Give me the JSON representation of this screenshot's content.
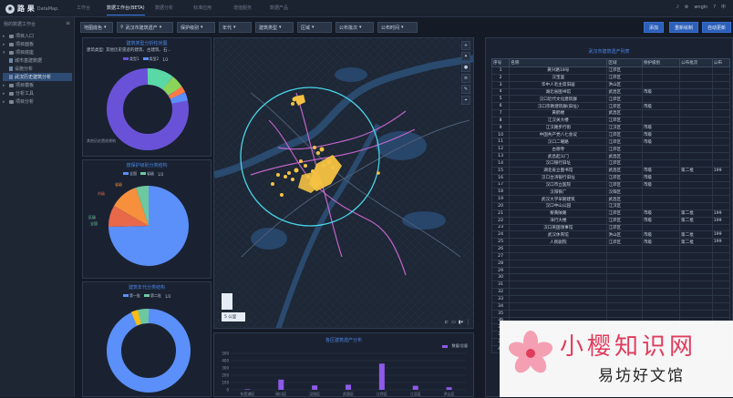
{
  "app": {
    "brand": "路 果",
    "sub": "DataMap.",
    "user": "wngln",
    "lang": "中"
  },
  "nav_tabs": [
    "工作台",
    "数据工作台(BETA)",
    "数据分析",
    "标准应用",
    "增值服务",
    "数据产品"
  ],
  "sidebar": {
    "header": "我的数据工作台",
    "items": [
      {
        "label": "项目入口",
        "level": 0,
        "type": "folder"
      },
      {
        "label": "项目面板",
        "level": 0,
        "type": "folder"
      },
      {
        "label": "项目底座",
        "level": 0,
        "type": "folder",
        "open": true
      },
      {
        "label": "城市基建数据",
        "level": 1,
        "type": "doc"
      },
      {
        "label": "设施分析",
        "level": 1,
        "type": "doc"
      },
      {
        "label": "武汉历史建筑分析",
        "level": 1,
        "type": "doc",
        "selected": true
      },
      {
        "label": "项目模板",
        "level": 0,
        "type": "folder"
      },
      {
        "label": "分析工具",
        "level": 0,
        "type": "folder"
      },
      {
        "label": "项目分析",
        "level": 0,
        "type": "folder"
      }
    ]
  },
  "toolbar": {
    "map_style": "地图底色",
    "layer": "武汉市建筑遗产",
    "filters": [
      "保护级别",
      "年代",
      "建筑类型",
      "区域",
      "公布批次",
      "公布时间"
    ],
    "actions": [
      "添加",
      "重新绘制",
      "自动更新"
    ]
  },
  "pie1": {
    "title": "建筑类型分析柱状图",
    "subtitle": "建筑类型: 其他历史遗迹的建筑、古建筑、石...",
    "legend": [
      "类型1",
      "类型2",
      "1/2"
    ],
    "footer": "其他历史遗迹建筑",
    "colors": [
      "#6a52d8",
      "#5b8ff9",
      "#5ad8a6",
      "#8bd45a",
      "#f6bd16",
      "#ff7a45"
    ]
  },
  "pie2": {
    "title": "按保护级别分类结构",
    "legend": [
      "全国",
      "省级",
      "1/2"
    ],
    "labels": [
      "省级",
      "市级",
      "区级",
      "全国"
    ],
    "colors": [
      "#5b8ff9",
      "#e8684a",
      "#f6903d",
      "#6dc8a0"
    ]
  },
  "pie3": {
    "title": "建筑年代分类结构",
    "legend": [
      "第一批",
      "第二批",
      "1/2"
    ],
    "colors": [
      "#5b8ff9",
      "#6dc8a0",
      "#f6bd16"
    ]
  },
  "map": {
    "scale": "5 公里",
    "north": "N"
  },
  "bottom_chart": {
    "title": "各区建筑遗产分布",
    "legend": "数量/总量",
    "y_ticks": [
      "500",
      "400",
      "300",
      "200",
      "100",
      "0"
    ],
    "x_labels": [
      "东西湖区",
      "硚口区",
      "汉阳区",
      "武昌区",
      "江岸区",
      "江汉区",
      "洪山区"
    ],
    "color": "#8e5ae8"
  },
  "chart_data": {
    "type": "bar",
    "title": "各区建筑遗产分布",
    "categories": [
      "东西湖区",
      "硚口区",
      "汉阳区",
      "武昌区",
      "江岸区",
      "江汉区",
      "洪山区"
    ],
    "values": [
      8,
      140,
      60,
      70,
      360,
      55,
      35
    ],
    "ylim": [
      0,
      500
    ]
  },
  "table": {
    "title": "武汉市建筑遗产列表",
    "columns": [
      "序号",
      "名称",
      "区域",
      "保护级别",
      "公布批次",
      "公布"
    ],
    "rows": [
      [
        "1",
        "黄兴路18号",
        "江岸区",
        "",
        "",
        ""
      ],
      [
        "2",
        "汉宝里",
        "江岸区",
        "",
        "",
        ""
      ],
      [
        "3",
        "华中人毛主席旧居",
        "洪山区",
        "",
        "",
        ""
      ],
      [
        "4",
        "湖北省图书馆",
        "武昌区",
        "市级",
        "",
        ""
      ],
      [
        "5",
        "汉口近代文化建筑群",
        "江岸区",
        "",
        "",
        ""
      ],
      [
        "6",
        "汉口宗教建筑群(旧址)",
        "江岸区",
        "市级",
        "",
        ""
      ],
      [
        "7",
        "黄鹤楼",
        "武昌区",
        "",
        "",
        ""
      ],
      [
        "8",
        "江汉关大楼",
        "江岸区",
        "",
        "",
        ""
      ],
      [
        "9",
        "江汉路步行街",
        "江汉区",
        "市级",
        "",
        ""
      ],
      [
        "10",
        "中国共产党八七会议",
        "江岸区",
        "市级",
        "",
        ""
      ],
      [
        "11",
        "汉口二曜路",
        "江岸区",
        "市级",
        "",
        ""
      ],
      [
        "12",
        "古德寺",
        "江岸区",
        "",
        "",
        ""
      ],
      [
        "13",
        "武昌起义门",
        "武昌区",
        "",
        "",
        ""
      ],
      [
        "14",
        "汉口银行旧址",
        "江岸区",
        "",
        "",
        ""
      ],
      [
        "15",
        "湖北省立图书馆",
        "武昌区",
        "市级",
        "第二批",
        "199"
      ],
      [
        "16",
        "汉口台湾银行旧址",
        "江岸区",
        "市级",
        "",
        ""
      ],
      [
        "17",
        "汉口市立医院",
        "江岸区",
        "市级",
        "",
        ""
      ],
      [
        "18",
        "汉阳铁厂",
        "汉阳区",
        "",
        "",
        ""
      ],
      [
        "19",
        "武汉大学早期建筑",
        "武昌区",
        "",
        "",
        ""
      ],
      [
        "20",
        "汉口中山公园",
        "江汉区",
        "",
        "",
        ""
      ],
      [
        "21",
        "黎黄陂路",
        "江岸区",
        "市级",
        "第二批",
        "199"
      ],
      [
        "22",
        "洋行大楼",
        "江岸区",
        "市级",
        "第二批",
        "199"
      ],
      [
        "23",
        "汉口英国领事馆",
        "江岸区",
        "",
        "",
        ""
      ],
      [
        "24",
        "武汉体育馆",
        "洪山区",
        "市级",
        "第二批",
        "199"
      ],
      [
        "25",
        "人民剧院",
        "江岸区",
        "市级",
        "第二批",
        "199"
      ],
      [
        "26",
        "",
        "",
        "",
        "",
        ""
      ],
      [
        "27",
        "",
        "",
        "",
        "",
        ""
      ],
      [
        "28",
        "",
        "",
        "",
        "",
        ""
      ],
      [
        "29",
        "",
        "",
        "",
        "",
        ""
      ],
      [
        "30",
        "",
        "",
        "",
        "",
        ""
      ],
      [
        "31",
        "",
        "",
        "",
        "",
        ""
      ],
      [
        "32",
        "",
        "",
        "",
        "",
        ""
      ],
      [
        "33",
        "",
        "",
        "",
        "",
        ""
      ],
      [
        "34",
        "",
        "",
        "",
        "",
        ""
      ],
      [
        "35",
        "",
        "",
        "",
        "",
        ""
      ],
      [
        "36",
        "",
        "",
        "",
        "",
        ""
      ],
      [
        "37",
        "",
        "",
        "",
        "",
        ""
      ],
      [
        "38",
        "",
        "",
        "",
        "",
        ""
      ],
      [
        "39",
        "",
        "",
        "",
        "",
        ""
      ],
      [
        "40",
        "",
        "",
        "",
        "",
        ""
      ]
    ]
  },
  "watermark": {
    "line1": "小樱知识网",
    "line2": "易坊好文馆"
  }
}
